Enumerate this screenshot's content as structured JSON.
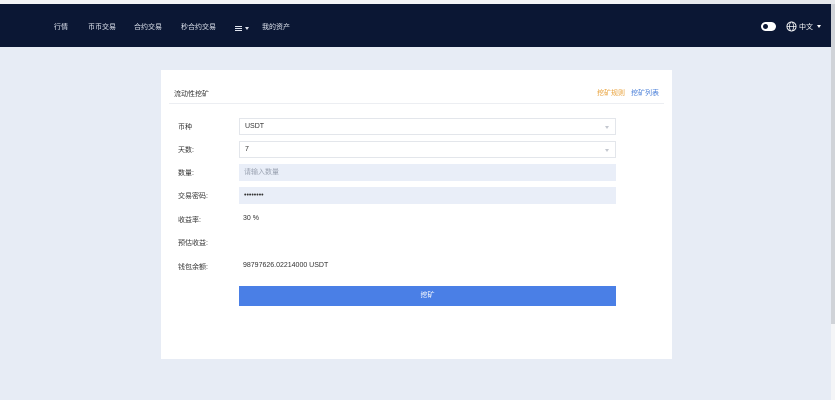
{
  "nav": {
    "items": [
      "行情",
      "币币交易",
      "合约交易",
      "秒合约交易"
    ],
    "assets_label": "我的资产",
    "language": "中文"
  },
  "card": {
    "title": "流动性挖矿",
    "rules_link": "挖矿规则",
    "list_link": "挖矿列表"
  },
  "form": {
    "currency": {
      "label": "币种",
      "value": "USDT"
    },
    "days": {
      "label": "天数:",
      "value": "7"
    },
    "amount": {
      "label": "数量:",
      "placeholder": "请输入数量"
    },
    "password": {
      "label": "交易密码:",
      "value": "••••••••"
    },
    "yield": {
      "label": "收益率:",
      "value": "30 %"
    },
    "expected": {
      "label": "预估收益:",
      "value": ""
    },
    "wallet": {
      "label": "钱包余额:",
      "value": "98797626.02214000 USDT"
    },
    "submit_label": "挖矿"
  },
  "colors": {
    "navbar": "#0b1734",
    "background": "#e7ecf5",
    "primary": "#4a7fe6",
    "rules_link": "#e9a23b",
    "list_link": "#4a7fd8"
  },
  "icons": [
    "grid-menu-icon",
    "chevron-down-icon",
    "theme-toggle-icon",
    "globe-icon"
  ]
}
